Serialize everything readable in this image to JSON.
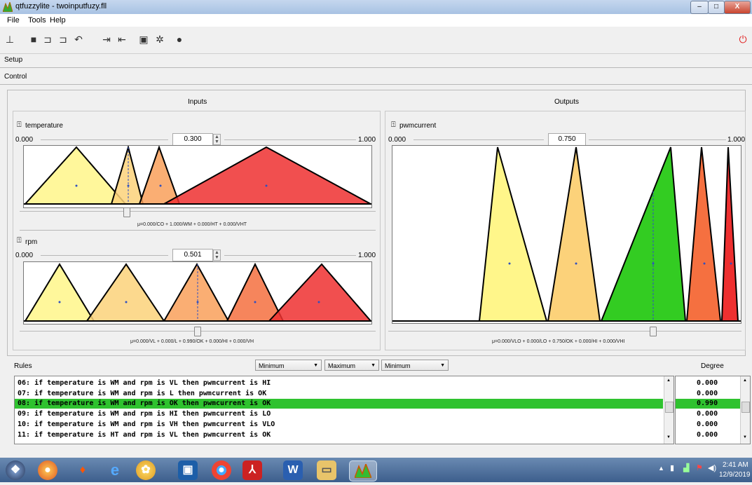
{
  "window": {
    "title": "qtfuzzylite - twoinputfuzy.fll"
  },
  "menu": [
    "File",
    "Tools",
    "Help"
  ],
  "sections": {
    "setup": "Setup",
    "control": "Control"
  },
  "inputs": {
    "header": "Inputs",
    "temperature": {
      "name": "temperature",
      "min": "0.000",
      "max": "1.000",
      "value": "0.300",
      "formula": "μ=0.000/CO + 1.000/WM + 0.000/HT + 0.000/VHT"
    },
    "rpm": {
      "name": "rpm",
      "min": "0.000",
      "max": "1.000",
      "value": "0.501",
      "formula": "μ=0.000/VL + 0.000/L + 0.990/OK + 0.000/HI + 0.000/VH"
    }
  },
  "outputs": {
    "header": "Outputs",
    "pwmcurrent": {
      "name": "pwmcurrent",
      "min": "0.000",
      "max": "1.000",
      "value": "0.750",
      "formula": "μ=0.000/VLO + 0.000/LO + 0.750/OK + 0.000/HI + 0.000/VHI"
    }
  },
  "rules": {
    "label": "Rules",
    "degree_label": "Degree",
    "combos": [
      "Minimum",
      "Maximum",
      "Minimum"
    ],
    "items": [
      {
        "text": "06: if temperature is WM and rpm is VL then pwmcurrent is HI",
        "degree": "0.000"
      },
      {
        "text": "07: if temperature is WM and rpm is L then pwmcurrent is OK",
        "degree": "0.000"
      },
      {
        "text": "08: if temperature is WM and rpm is OK then pwmcurrent is OK",
        "degree": "0.990",
        "selected": true
      },
      {
        "text": "09: if temperature is WM and rpm is HI then pwmcurrent is LO",
        "degree": "0.000"
      },
      {
        "text": "10: if temperature is WM and rpm is VH then pwmcurrent is VLO",
        "degree": "0.000"
      },
      {
        "text": "11: if temperature is HT and rpm is VL then pwmcurrent is OK",
        "degree": "0.000"
      }
    ]
  },
  "taskbar": {
    "time": "2:41 AM",
    "date": "12/9/2019"
  },
  "colors": {
    "selection": "#2fc22f",
    "yellow": "#fff68a",
    "lightorange": "#fcd27a",
    "orange": "#f9a05a",
    "darkorange": "#f57040",
    "red": "#ee3030",
    "green": "#33cc22"
  }
}
